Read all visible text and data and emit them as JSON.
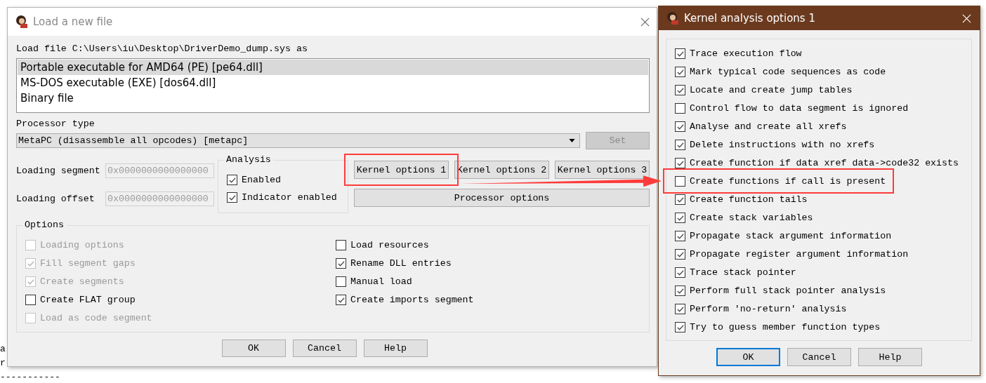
{
  "background_text": [
    "a",
    "r",
    "-----------"
  ],
  "load_dialog": {
    "title": "Load a new file",
    "file_label": "Load file C:\\Users\\iu\\Desktop\\DriverDemo_dump.sys as",
    "formats": [
      {
        "label": "Portable executable for AMD64 (PE) [pe64.dll]",
        "selected": true
      },
      {
        "label": "MS-DOS executable (EXE) [dos64.dll]",
        "selected": false
      },
      {
        "label": "Binary file",
        "selected": false
      }
    ],
    "processor_label": "Processor type",
    "processor": {
      "value": "MetaPC (disassemble all opcodes) [metapc]"
    },
    "set_button": {
      "label": "Set",
      "disabled": true
    },
    "fields": [
      {
        "label": "Loading segment",
        "value": "0x0000000000000000",
        "disabled": true
      },
      {
        "label": "Loading offset",
        "value": "0x0000000000000000",
        "disabled": true
      }
    ],
    "analysis": {
      "title": "Analysis",
      "items": [
        {
          "label": "Enabled",
          "checked": true
        },
        {
          "label": "Indicator enabled",
          "checked": true
        }
      ]
    },
    "kernel_buttons": [
      {
        "label": "Kernel options 1",
        "highlighted": true
      },
      {
        "label": "Kernel options 2",
        "highlighted": false
      },
      {
        "label": "Kernel options 3",
        "highlighted": false
      }
    ],
    "processor_button": "Processor options",
    "options": {
      "title": "Options",
      "left": [
        {
          "label": "Loading options",
          "checked": false,
          "disabled": true
        },
        {
          "label": "Fill segment gaps",
          "checked": true,
          "disabled": true
        },
        {
          "label": "Create segments",
          "checked": true,
          "disabled": true
        },
        {
          "label": "Create FLAT group",
          "checked": false,
          "disabled": false
        },
        {
          "label": "Load as code segment",
          "checked": false,
          "disabled": true
        }
      ],
      "right": [
        {
          "label": "Load resources",
          "checked": false,
          "disabled": false
        },
        {
          "label": "Rename DLL entries",
          "checked": true,
          "disabled": false
        },
        {
          "label": "Manual load",
          "checked": false,
          "disabled": false
        },
        {
          "label": "Create imports segment",
          "checked": true,
          "disabled": false
        }
      ]
    },
    "buttons": [
      "OK",
      "Cancel",
      "Help"
    ]
  },
  "kernel_dialog": {
    "title": "Kernel analysis options 1",
    "items": [
      {
        "label": "Trace execution flow",
        "checked": true,
        "highlighted": false
      },
      {
        "label": "Mark typical code sequences as code",
        "checked": true,
        "highlighted": false
      },
      {
        "label": "Locate and create jump tables",
        "checked": true,
        "highlighted": false
      },
      {
        "label": "Control flow to data segment is ignored",
        "checked": false,
        "highlighted": false
      },
      {
        "label": "Analyse and create all xrefs",
        "checked": true,
        "highlighted": false
      },
      {
        "label": "Delete instructions with no xrefs",
        "checked": true,
        "highlighted": false
      },
      {
        "label": "Create function if data xref data->code32 exists",
        "checked": true,
        "highlighted": false
      },
      {
        "label": "Create functions if call is present",
        "checked": false,
        "highlighted": true
      },
      {
        "label": "Create function tails",
        "checked": true,
        "highlighted": false
      },
      {
        "label": "Create stack variables",
        "checked": true,
        "highlighted": false
      },
      {
        "label": "Propagate stack argument information",
        "checked": true,
        "highlighted": false
      },
      {
        "label": "Propagate register argument information",
        "checked": true,
        "highlighted": false
      },
      {
        "label": "Trace stack pointer",
        "checked": true,
        "highlighted": false
      },
      {
        "label": "Perform full stack pointer analysis",
        "checked": true,
        "highlighted": false
      },
      {
        "label": "Perform 'no-return' analysis",
        "checked": true,
        "highlighted": false
      },
      {
        "label": "Try to guess member function types",
        "checked": true,
        "highlighted": false
      }
    ],
    "buttons": [
      {
        "label": "OK",
        "focused": true
      },
      {
        "label": "Cancel",
        "focused": false
      },
      {
        "label": "Help",
        "focused": false
      }
    ]
  }
}
